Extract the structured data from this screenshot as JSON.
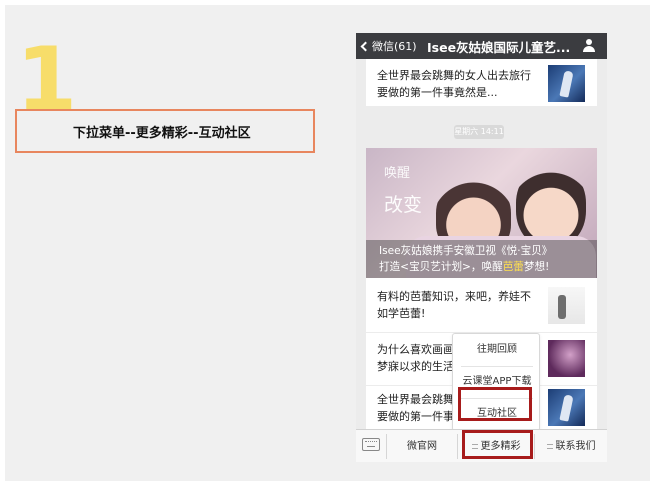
{
  "tutorial": {
    "step_number": "1",
    "instruction": "下拉菜单--更多精彩--互动社区",
    "colors": {
      "step_number": "#f7dd6a",
      "instruction_border": "#e8865e",
      "highlight": "#a71b1b"
    }
  },
  "header": {
    "back_label": "微信(61)",
    "title": "Isee灰姑娘国际儿童艺...",
    "user_icon": "user-icon"
  },
  "articles_top": [
    {
      "title": "全世界最会跳舞的女人出去旅行要做的第一件事竟然是..."
    }
  ],
  "timestamp": "星期六 14:11",
  "banner": {
    "logo_top": "唤醒",
    "logo_bottom": "改变",
    "caption_prefix": "Isee灰姑娘携手安徽卫视《悦·宝贝》",
    "caption_line2_start": "打造<宝贝艺计划>，唤醒",
    "caption_highlight": "芭蕾",
    "caption_line2_end": "梦想!"
  },
  "articles": [
    {
      "title": "有料的芭蕾知识，来吧，养娃不如学芭蕾!"
    },
    {
      "title": "为什么喜欢画画梦寐以求的生活"
    },
    {
      "title": "全世界最会跳舞要做的第一件事"
    }
  ],
  "dropdown_menu": {
    "items": [
      "往期回顾",
      "云课堂APP下载",
      "互动社区"
    ],
    "highlighted": "互动社区"
  },
  "bottom_bar": {
    "keyboard_icon": "keyboard-icon",
    "tabs": [
      "微官网",
      "更多精彩",
      "联系我们"
    ],
    "highlighted": "更多精彩"
  }
}
